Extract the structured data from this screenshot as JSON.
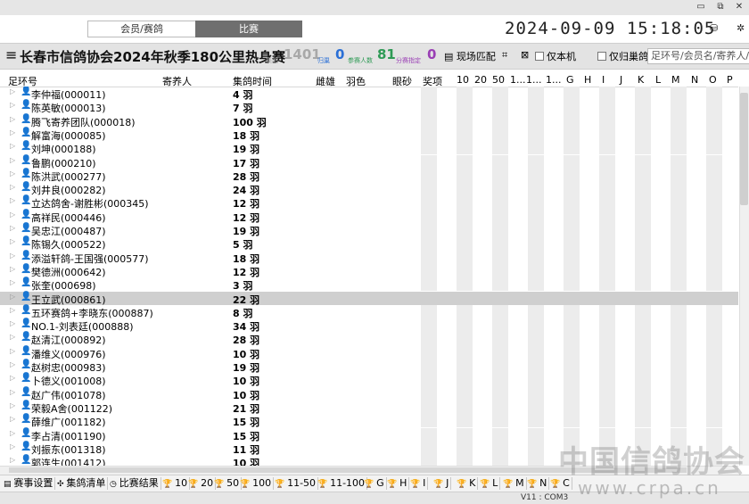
{
  "window": {
    "controls": [
      "▭",
      "⧉",
      "✕"
    ]
  },
  "topbar": {
    "tab_member": "会员/赛鸽",
    "tab_race": "比赛",
    "clock": "2024-09-09 15:18:05"
  },
  "header": {
    "race_title": "长春市信鸽协会2024年秋季180公里热身赛",
    "stat1_label": "集鸽",
    "stat1_value": "1401",
    "stat2_label": "归巢",
    "stat2_value": "0",
    "stat3_label": "参赛人数",
    "stat3_value": "81",
    "stat4_label": "分赛指定",
    "stat4_value": "0",
    "btn_match": "现场匹配",
    "chk_local": "仅本机",
    "chk_return": "仅归巢鸽",
    "search_placeholder": "足环号/会员名/寄养人/鸽"
  },
  "columns": [
    "足环号",
    "寄养人",
    "集鸽时间",
    "雌雄",
    "羽色",
    "眼砂",
    "奖项",
    "10",
    "20",
    "50",
    "1...",
    "1...",
    "1...",
    "G",
    "H",
    "I",
    "J",
    "K",
    "L",
    "M",
    "N",
    "O",
    "P"
  ],
  "rows": [
    {
      "name": "李仲福(000011)",
      "count": "4 羽"
    },
    {
      "name": "陈英敏(000013)",
      "count": "7 羽"
    },
    {
      "name": "腾飞寄养团队(000018)",
      "count": "100 羽"
    },
    {
      "name": "解富海(000085)",
      "count": "18 羽"
    },
    {
      "name": "刘坤(000188)",
      "count": "19 羽"
    },
    {
      "name": "鲁鹏(000210)",
      "count": "17 羽"
    },
    {
      "name": "陈洪武(000277)",
      "count": "28 羽"
    },
    {
      "name": "刘井良(000282)",
      "count": "24 羽"
    },
    {
      "name": "立达鸽舍-谢胜彬(000345)",
      "count": "12 羽"
    },
    {
      "name": "高祥民(000446)",
      "count": "12 羽"
    },
    {
      "name": "吴忠江(000487)",
      "count": "19 羽"
    },
    {
      "name": "陈锡久(000522)",
      "count": "5 羽"
    },
    {
      "name": "添溢轩鸽-王国强(000577)",
      "count": "18 羽"
    },
    {
      "name": "樊德洲(000642)",
      "count": "12 羽"
    },
    {
      "name": "张奎(000698)",
      "count": "3 羽"
    },
    {
      "name": "王立武(000861)",
      "count": "22 羽",
      "selected": true
    },
    {
      "name": "五环赛鸽+李晓东(000887)",
      "count": "8 羽"
    },
    {
      "name": "NO.1-刘表廷(000888)",
      "count": "34 羽"
    },
    {
      "name": "赵清江(000892)",
      "count": "28 羽"
    },
    {
      "name": "潘维义(000976)",
      "count": "10 羽"
    },
    {
      "name": "赵树忠(000983)",
      "count": "19 羽"
    },
    {
      "name": "卜德义(001008)",
      "count": "10 羽"
    },
    {
      "name": "赵广伟(001078)",
      "count": "10 羽"
    },
    {
      "name": "荣毅A舍(001122)",
      "count": "21 羽"
    },
    {
      "name": "薛维广(001182)",
      "count": "15 羽"
    },
    {
      "name": "李占清(001190)",
      "count": "15 羽"
    },
    {
      "name": "刘振东(001318)",
      "count": "11 羽"
    },
    {
      "name": "郭连生(001412)",
      "count": "10 羽"
    }
  ],
  "bottom_tabs": [
    "赛事设置",
    "集鸽清单",
    "比赛结果",
    "10",
    "20",
    "50",
    "100",
    "11-50",
    "11-100",
    "G",
    "H",
    "I",
    "J",
    "K",
    "L",
    "M",
    "N",
    "C"
  ],
  "status": {
    "port": "V11 : COM3"
  },
  "watermark": {
    "line1": "中国信鸽协会",
    "line2": "www.crpa.cn"
  }
}
